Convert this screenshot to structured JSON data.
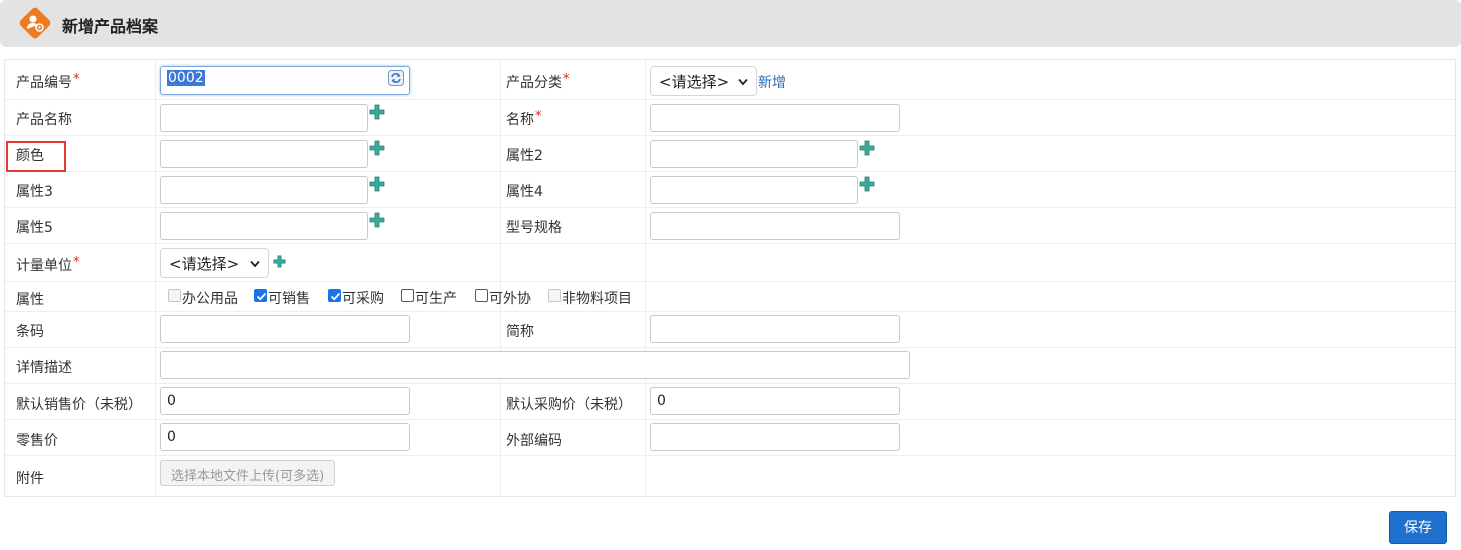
{
  "header": {
    "title": "新增产品档案"
  },
  "colors": {
    "accent": "#1f6fcf",
    "icon_orange": "#ee7b22",
    "plus_green": "#3aaa9a",
    "required": "#e02020",
    "highlight": "#e53935"
  },
  "form": {
    "product_code": {
      "label": "产品编号",
      "value": "0002"
    },
    "product_category": {
      "label": "产品分类",
      "selected": "<请选择>",
      "add_link": "新增"
    },
    "product_name": {
      "label": "产品名称",
      "value": ""
    },
    "name": {
      "label": "名称",
      "value": ""
    },
    "color": {
      "label": "颜色",
      "value": ""
    },
    "attr2": {
      "label": "属性2",
      "value": ""
    },
    "attr3": {
      "label": "属性3",
      "value": ""
    },
    "attr4": {
      "label": "属性4",
      "value": ""
    },
    "attr5": {
      "label": "属性5",
      "value": ""
    },
    "model_spec": {
      "label": "型号规格",
      "value": ""
    },
    "unit": {
      "label": "计量单位",
      "selected": "<请选择>"
    },
    "properties": {
      "label": "属性",
      "options": [
        {
          "label": "办公用品",
          "checked": false,
          "disabled": true
        },
        {
          "label": "可销售",
          "checked": true,
          "disabled": false
        },
        {
          "label": "可采购",
          "checked": true,
          "disabled": false
        },
        {
          "label": "可生产",
          "checked": false,
          "disabled": false
        },
        {
          "label": "可外协",
          "checked": false,
          "disabled": false
        },
        {
          "label": "非物料项目",
          "checked": false,
          "disabled": true
        }
      ]
    },
    "barcode": {
      "label": "条码",
      "value": ""
    },
    "short_name": {
      "label": "简称",
      "value": ""
    },
    "description": {
      "label": "详情描述",
      "value": ""
    },
    "default_sale_price": {
      "label": "默认销售价（未税）",
      "value": "0"
    },
    "default_purchase_price": {
      "label": "默认采购价（未税）",
      "value": "0"
    },
    "retail_price": {
      "label": "零售价",
      "value": "0"
    },
    "external_code": {
      "label": "外部编码",
      "value": ""
    },
    "attachment": {
      "label": "附件",
      "button": "选择本地文件上传(可多选)"
    }
  },
  "actions": {
    "save": "保存"
  }
}
